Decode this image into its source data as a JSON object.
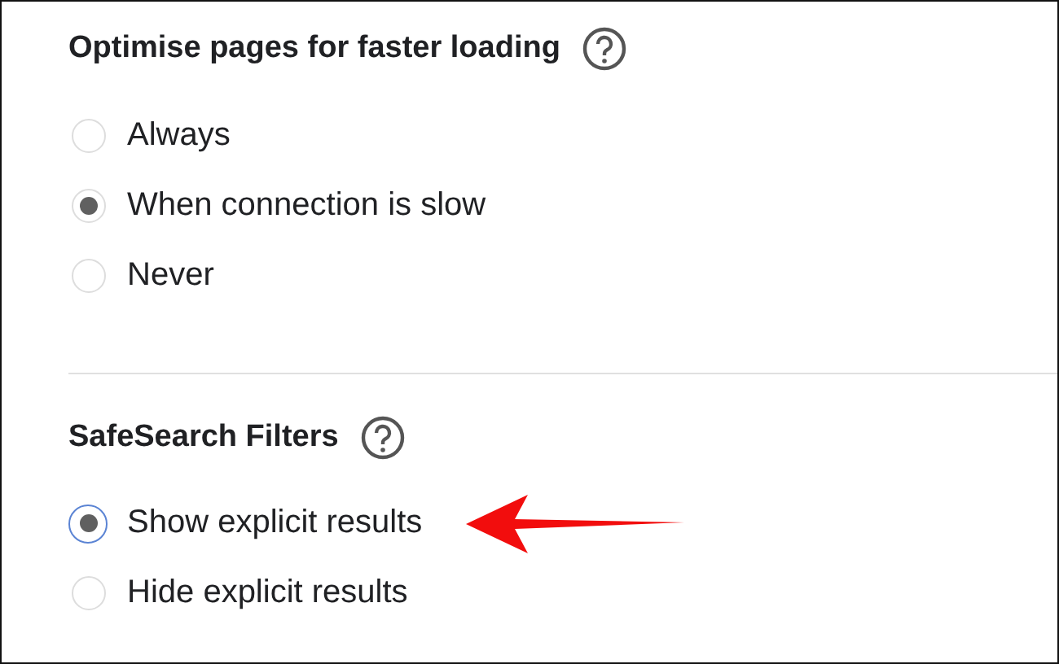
{
  "sections": [
    {
      "title": "Optimise pages for faster loading",
      "help": true,
      "options": [
        {
          "label": "Always",
          "selected": false,
          "focused": false
        },
        {
          "label": "When connection is slow",
          "selected": true,
          "focused": false
        },
        {
          "label": "Never",
          "selected": false,
          "focused": false
        }
      ]
    },
    {
      "title": "SafeSearch Filters",
      "help": true,
      "options": [
        {
          "label": "Show explicit results",
          "selected": true,
          "focused": true
        },
        {
          "label": "Hide explicit results",
          "selected": false,
          "focused": false
        }
      ]
    }
  ]
}
